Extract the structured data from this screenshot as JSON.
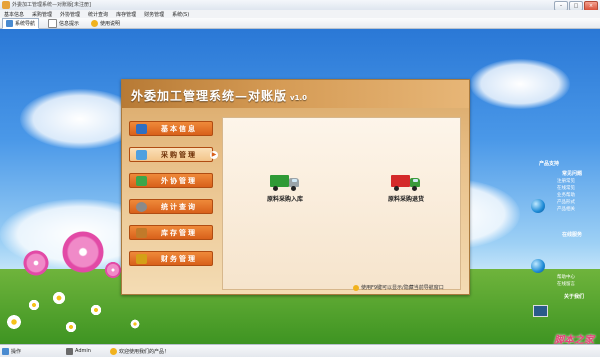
{
  "window": {
    "title": "外委加工管理系统—对账版[未注册]",
    "buttons": {
      "minimize": "–",
      "maximize": "□",
      "close": "×"
    }
  },
  "menu": [
    "基本信息",
    "采购管理",
    "外协管理",
    "统计查询",
    "库存管理",
    "财务管理",
    "系统(S)"
  ],
  "toolbar": [
    {
      "label": "系统导航",
      "icon": "navigation-icon",
      "color": "#4a8bd0"
    },
    {
      "label": "信息提示",
      "icon": "info-icon",
      "color": "#888888"
    },
    {
      "label": "使用说明",
      "icon": "help-icon",
      "color": "#f1b21d"
    }
  ],
  "panel": {
    "title": "外委加工管理系统—对账版",
    "version": "v1.0",
    "modules": [
      {
        "label": "基本信息",
        "icon": "info-icon",
        "icon_color": "#2f6fc2",
        "selected": false
      },
      {
        "label": "采购管理",
        "icon": "purchase-icon",
        "icon_color": "#4fa0e0",
        "selected": true
      },
      {
        "label": "外协管理",
        "icon": "outsource-icon",
        "icon_color": "#3ca64a",
        "selected": false
      },
      {
        "label": "统计查询",
        "icon": "query-icon",
        "icon_color": "#8a8a8a",
        "selected": false
      },
      {
        "label": "库存管理",
        "icon": "inventory-icon",
        "icon_color": "#c07a2a",
        "selected": false
      },
      {
        "label": "财务管理",
        "icon": "finance-icon",
        "icon_color": "#d4a017",
        "selected": false
      }
    ],
    "actions": [
      {
        "label": "原料采购入库",
        "icon": "green-truck-icon",
        "box_color": "#2e9a36",
        "cab_color": "#9aa3a8"
      },
      {
        "label": "原料采购退货",
        "icon": "red-truck-icon",
        "box_color": "#d42a2a",
        "cab_color": "#3a9a3a"
      }
    ],
    "hint": "使用F9键可以显示/隐藏当前导航窗口"
  },
  "side_widget": {
    "title": "产品支持",
    "sections": [
      {
        "title": "常见问题",
        "items": [
          "注册常见",
          "在线常见",
          "业务帮助",
          "产品形式",
          "产品相关"
        ]
      },
      {
        "title": "在线服务",
        "items": [
          "帮助中心",
          "在线留言"
        ]
      },
      {
        "title": "关于我们",
        "items": []
      }
    ]
  },
  "status": {
    "user_label": "操作",
    "user": "Admin",
    "message": "欢迎使用我们的产品！"
  },
  "watermark": "脚本之家"
}
